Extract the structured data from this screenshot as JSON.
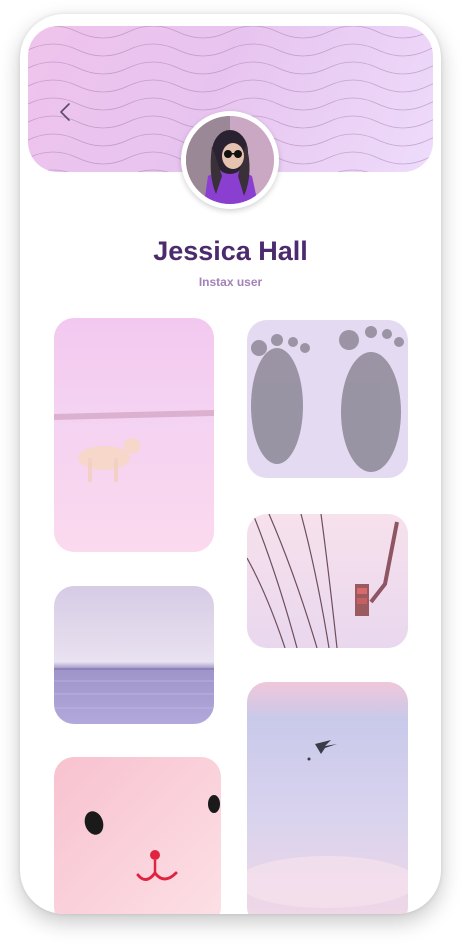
{
  "profile": {
    "name": "Jessica Hall",
    "subtitle": "Instax user"
  },
  "colors": {
    "name": "#4c2a6e",
    "subtitle": "#a481b8",
    "banner": "#e7c4ef"
  },
  "icons": {
    "back": "chevron-left-icon"
  },
  "gallery": {
    "photos": [
      "snowy-field-dog-photo",
      "footprints-photo",
      "power-lines-traffic-light-photo",
      "sea-horizon-photo",
      "bunny-face-photo",
      "sky-airplane-photo"
    ]
  }
}
